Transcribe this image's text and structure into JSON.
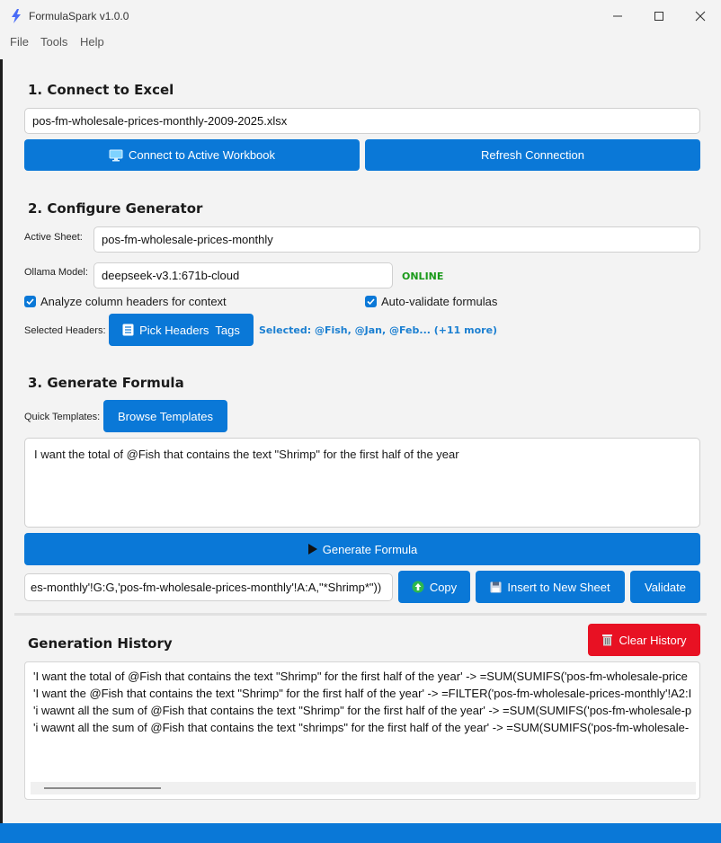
{
  "app": {
    "title": "FormulaSpark v1.0.0"
  },
  "menu": [
    "File",
    "Tools",
    "Help"
  ],
  "section1": {
    "heading": "1. Connect to Excel",
    "workbook_value": "pos-fm-wholesale-prices-monthly-2009-2025.xlsx",
    "connect_label": "Connect to Active Workbook",
    "refresh_label": "Refresh Connection"
  },
  "section2": {
    "heading": "2. Configure Generator",
    "active_sheet_label": "Active Sheet:",
    "active_sheet_value": "pos-fm-wholesale-prices-monthly",
    "model_label": "Ollama Model:",
    "model_value": "deepseek-v3.1:671b-cloud",
    "model_status": "ONLINE",
    "analyze_label": "Analyze column headers for context",
    "autovalidate_label": "Auto-validate formulas",
    "selected_headers_label": "Selected Headers:",
    "pick_headers_label": "Pick Headers  Tags",
    "selected_summary": "Selected: @Fish, @Jan, @Feb... (+11 more)"
  },
  "section3": {
    "heading": "3. Generate Formula",
    "quick_templates_label": "Quick Templates:",
    "browse_templates_label": "Browse Templates",
    "prompt_text": "I want the total of @Fish that contains the text \"Shrimp\" for the first half of the year",
    "generate_label": "Generate Formula",
    "formula_output": "es-monthly'!G:G,'pos-fm-wholesale-prices-monthly'!A:A,\"*Shrimp*\"))",
    "copy_label": "Copy",
    "insert_label": "Insert to New Sheet",
    "validate_label": "Validate"
  },
  "history": {
    "heading": "Generation History",
    "clear_label": "Clear History",
    "entries": [
      "'I want the total of @Fish that contains the text \"Shrimp\" for the first half of the year' -> =SUM(SUMIFS('pos-fm-wholesale-price",
      "'I want the @Fish that contains the text \"Shrimp\" for the first half of the year' -> =FILTER('pos-fm-wholesale-prices-monthly'!A2:I",
      "'i wawnt all the sum of @Fish that contains the text \"Shrimp\" for the first half of the year' -> =SUM(SUMIFS('pos-fm-wholesale-p",
      "'i wawnt all the sum of @Fish that contains the text \"shrimps\" for the first half of the year' -> =SUM(SUMIFS('pos-fm-wholesale-"
    ]
  },
  "colors": {
    "accent": "#0a78d7",
    "danger": "#e81123",
    "online": "#1a9a1a",
    "link": "#1b7fd1"
  },
  "icons": {
    "app": "lightning-icon",
    "connect": "monitor-icon",
    "pick": "list-icon",
    "generate": "play-icon",
    "copy": "up-arrow-circle-icon",
    "insert": "floppy-icon",
    "clear": "trash-icon"
  }
}
